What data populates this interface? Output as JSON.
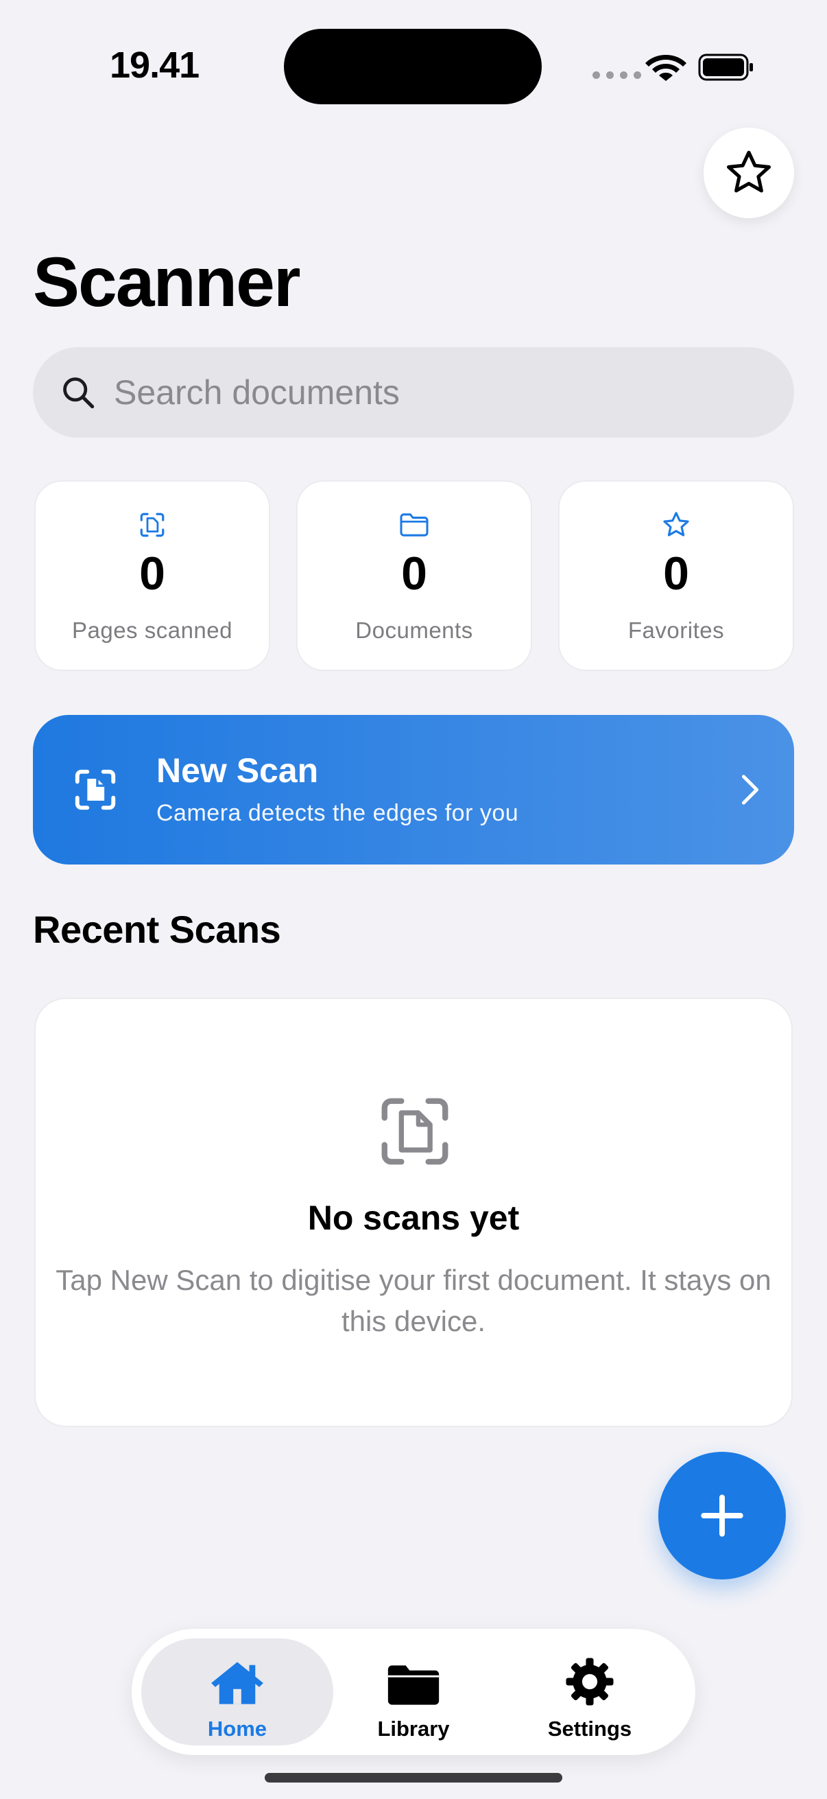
{
  "status_bar": {
    "time": "19.41"
  },
  "header": {
    "title": "Scanner"
  },
  "search": {
    "placeholder": "Search documents",
    "value": ""
  },
  "stats": [
    {
      "value": "0",
      "label": "Pages scanned",
      "icon": "scan-page-icon"
    },
    {
      "value": "0",
      "label": "Documents",
      "icon": "folder-icon"
    },
    {
      "value": "0",
      "label": "Favorites",
      "icon": "star-icon"
    }
  ],
  "new_scan": {
    "title": "New Scan",
    "subtitle": "Camera detects the edges for you"
  },
  "recent": {
    "title": "Recent Scans",
    "empty_title": "No scans yet",
    "empty_body": "Tap New Scan to digitise your first document. It stays on this device."
  },
  "tabs": [
    {
      "label": "Home",
      "icon": "house-icon",
      "active": true
    },
    {
      "label": "Library",
      "icon": "folder-icon",
      "active": false
    },
    {
      "label": "Settings",
      "icon": "gear-icon",
      "active": false
    }
  ],
  "colors": {
    "accent": "#1b7ae4",
    "background": "#f2f2f7",
    "secondary_text": "#8a8a8e"
  }
}
